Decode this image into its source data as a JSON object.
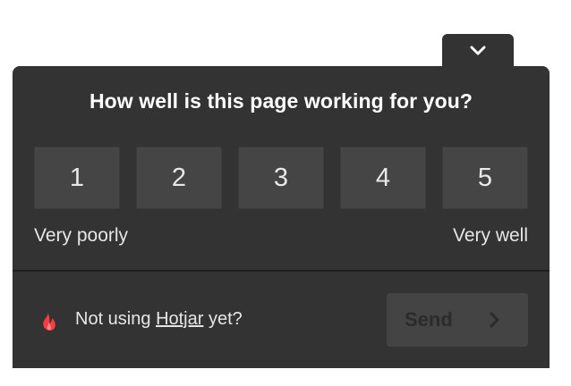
{
  "feedback": {
    "question": "How well is this page working for you?",
    "ratings": [
      "1",
      "2",
      "3",
      "4",
      "5"
    ],
    "scale_low_label": "Very poorly",
    "scale_high_label": "Very well"
  },
  "footer": {
    "prefix": "Not using",
    "brand_link": "Hotjar",
    "suffix": "yet?",
    "send_label": "Send"
  },
  "icons": {
    "collapse": "chevron-down-icon",
    "brand": "hotjar-flame-icon",
    "send": "chevron-right-icon"
  },
  "colors": {
    "panel": "#333333",
    "rating_button": "#454545",
    "brand_flame": "#ff3c41",
    "send_disabled": "#444444"
  }
}
